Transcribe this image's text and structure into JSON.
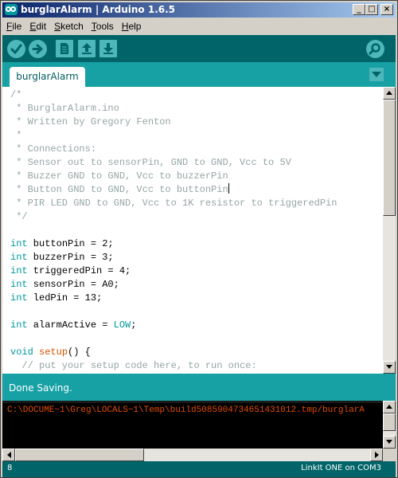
{
  "window": {
    "title": "burglarAlarm | Arduino 1.6.5",
    "controls": {
      "minimize": "_",
      "maximize": "□",
      "close": "×"
    }
  },
  "menu": [
    {
      "label": "File",
      "mnemonic": "F"
    },
    {
      "label": "Edit",
      "mnemonic": "E"
    },
    {
      "label": "Sketch",
      "mnemonic": "S"
    },
    {
      "label": "Tools",
      "mnemonic": "T"
    },
    {
      "label": "Help",
      "mnemonic": "H"
    }
  ],
  "toolbar": {
    "buttons": [
      "verify-icon",
      "upload-icon",
      "new-icon",
      "open-icon",
      "save-icon"
    ],
    "serial_monitor": "magnifier-icon"
  },
  "tabs": [
    {
      "label": "burglarAlarm"
    }
  ],
  "editor": {
    "lines": [
      "/*",
      " * BurglarAlarm.ino",
      " * Written by Gregory Fenton",
      " *",
      " * Connections:",
      " * Sensor out to sensorPin, GND to GND, Vcc to 5V",
      " * Buzzer GND to GND, Vcc to buzzerPin",
      " * Button GND to GND, Vcc to buttonPin",
      " * PIR LED GND to GND, Vcc to 1K resistor to triggeredPin",
      " */",
      "",
      "int buttonPin = 2;",
      "int buzzerPin = 3;",
      "int triggeredPin = 4;",
      "int sensorPin = A0;",
      "int ledPin = 13;",
      "",
      "int alarmActive = LOW;",
      "",
      "void setup() {",
      "  // put your setup code here, to run once:"
    ]
  },
  "status": {
    "message": "Done Saving."
  },
  "console": {
    "line": "C:\\DOCUME~1\\Greg\\LOCALS~1\\Temp\\build5085904734651431012.tmp/burglarA"
  },
  "footer": {
    "line_number": "8",
    "board": "LinkIt ONE on COM3"
  },
  "colors": {
    "toolbar": "#006468",
    "tabstrip": "#17a1a5",
    "button": "#4db7bb",
    "keyword": "#00979c",
    "function": "#d35400",
    "comment": "#95a5a6",
    "console_text": "#e34c00"
  }
}
